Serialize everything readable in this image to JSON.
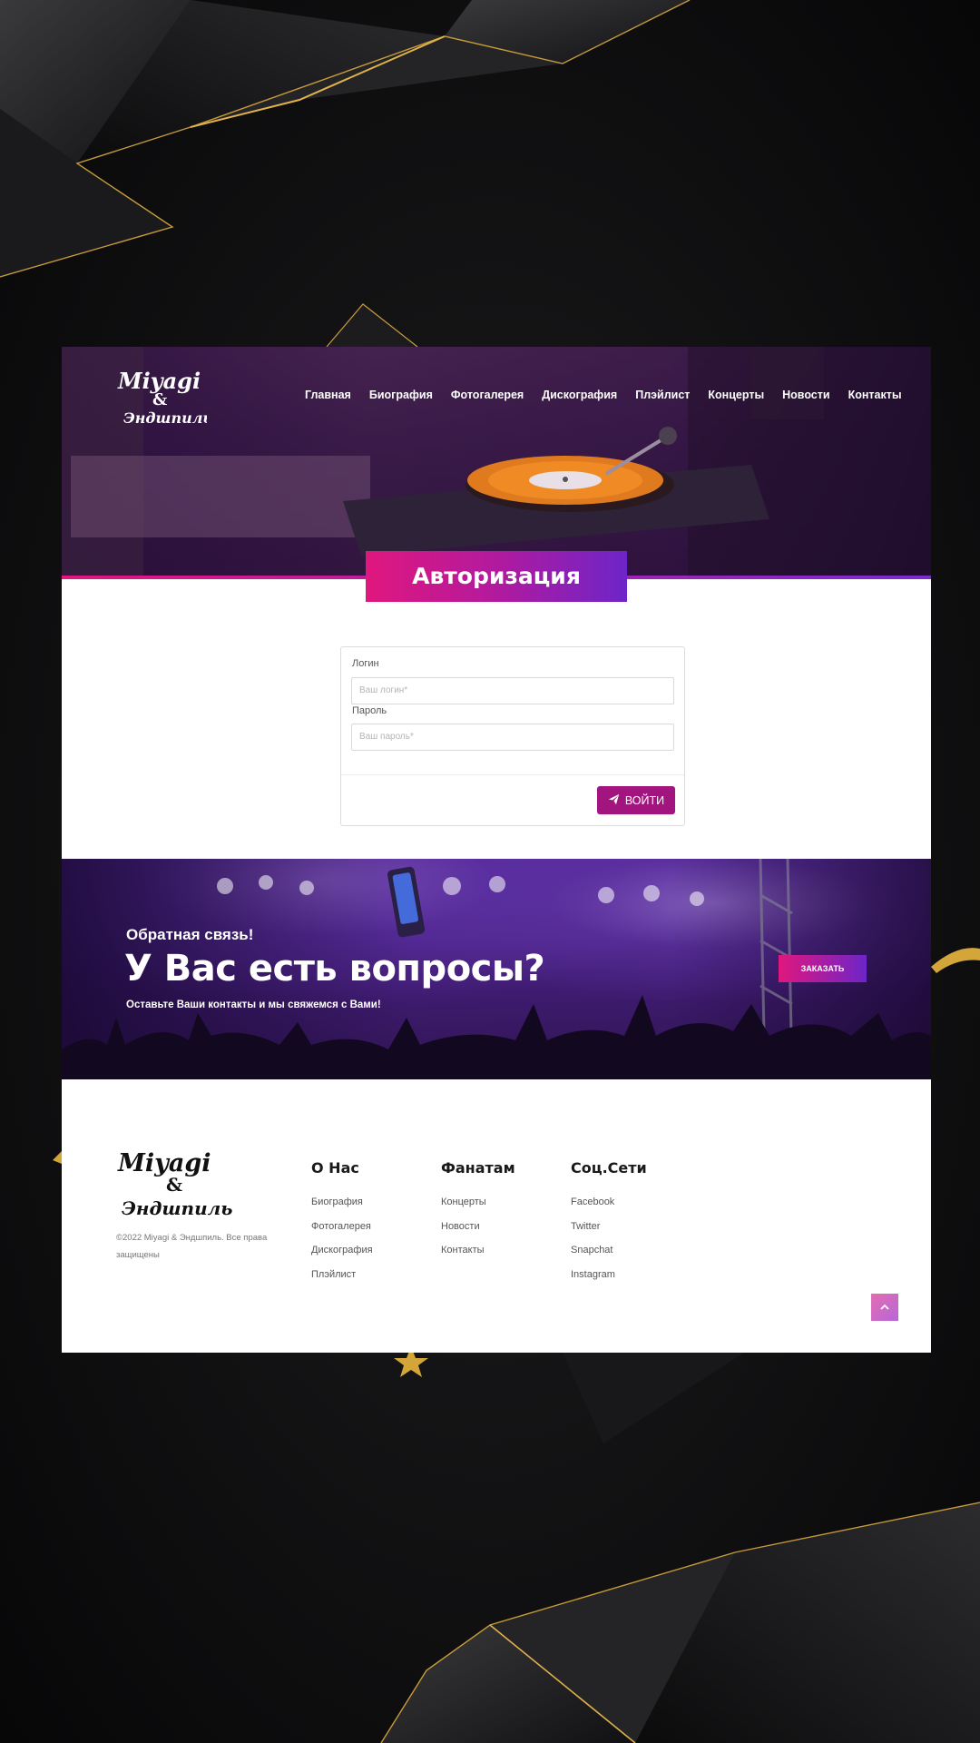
{
  "brand": {
    "logo_line1": "Miyagi",
    "logo_amp": "&",
    "logo_line2": "Эндшпиль"
  },
  "nav": {
    "items": [
      "Главная",
      "Биография",
      "Фотогалерея",
      "Дискография",
      "Плэйлист",
      "Концерты",
      "Новости",
      "Контакты"
    ]
  },
  "auth": {
    "title": "Авторизация",
    "login_label": "Логин",
    "login_placeholder": "Ваш логин*",
    "password_label": "Пароль",
    "password_placeholder": "Ваш пароль*",
    "submit_label": "ВОЙТИ"
  },
  "feedback": {
    "subtitle": "Обратная связь!",
    "title": "У Вас есть вопросы?",
    "text": "Оставьте Ваши контакты и мы свяжемся с Вами!",
    "button_label": "ЗАКАЗАТЬ"
  },
  "footer": {
    "copyright": "©2022 Miyagi & Эндшпиль. Все права защищены",
    "columns": [
      {
        "title": "О Нас",
        "links": [
          "Биография",
          "Фотогалерея",
          "Дискография",
          "Плэйлист"
        ]
      },
      {
        "title": "Фанатам",
        "links": [
          "Концерты",
          "Новости",
          "Контакты"
        ]
      },
      {
        "title": "Соц.Сети",
        "links": [
          "Facebook",
          "Twitter",
          "Snapchat",
          "Instagram"
        ]
      }
    ],
    "scroll_top_icon": "chevron-up-icon"
  },
  "colors": {
    "accent_pink": "#e0177e",
    "accent_purple": "#6d25c8",
    "button_magenta": "#a3157e",
    "gold": "#d4a63a"
  }
}
